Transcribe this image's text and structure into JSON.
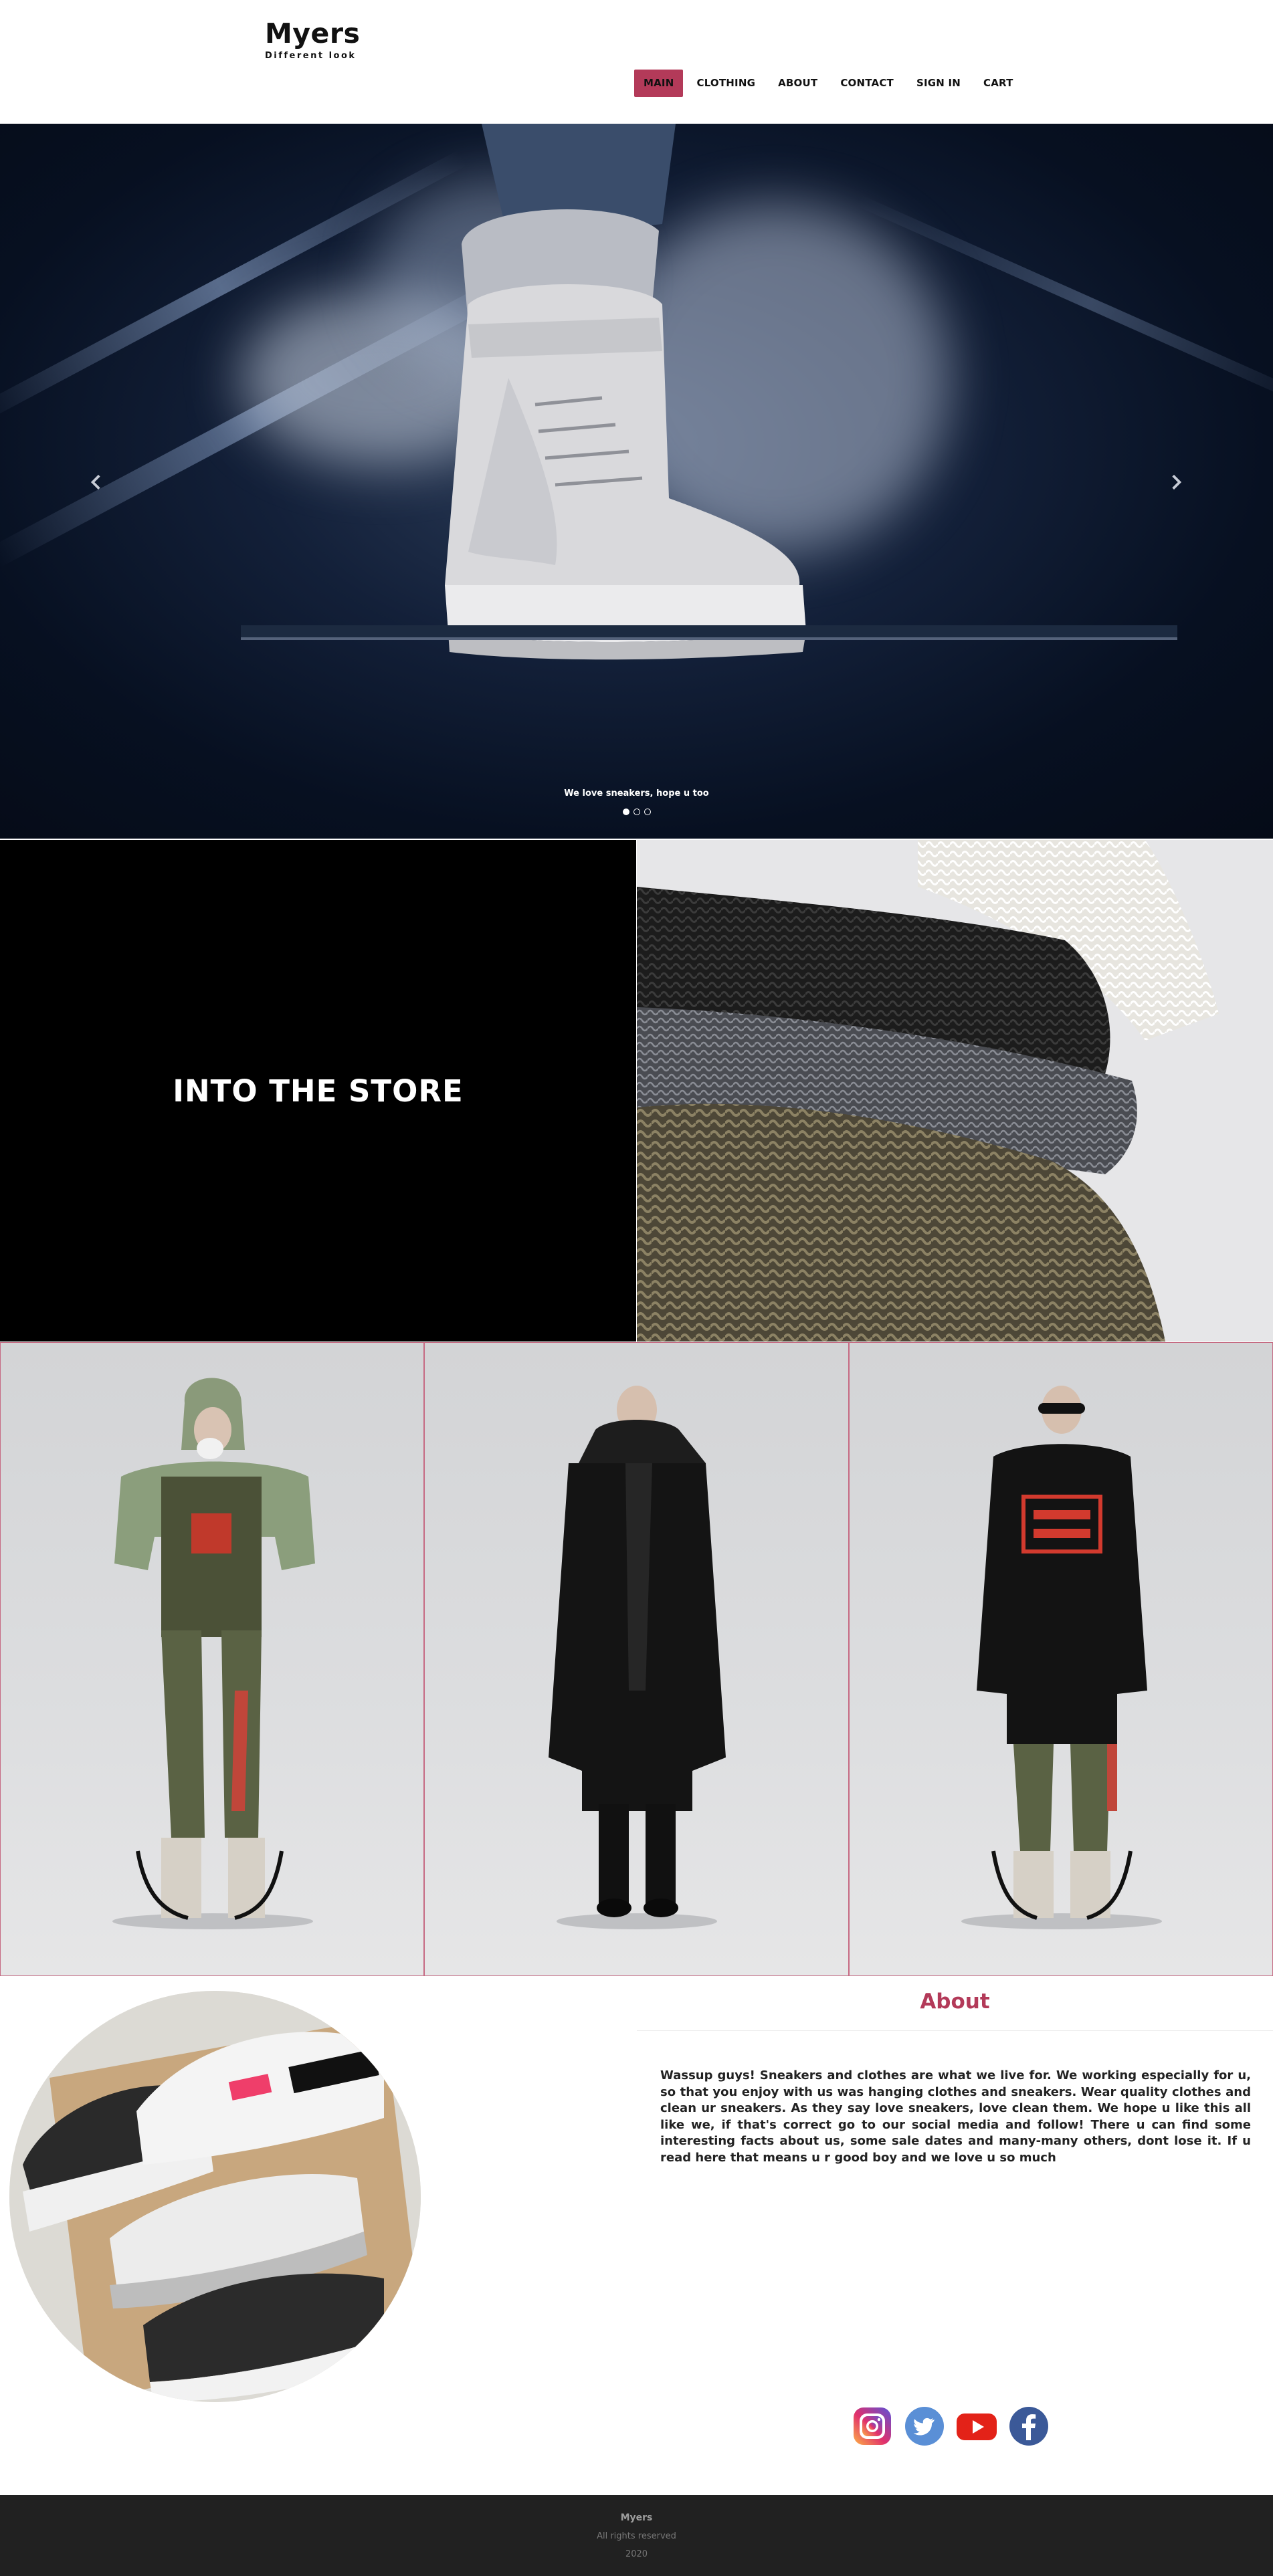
{
  "brand": {
    "name": "Myers",
    "tagline": "Different look"
  },
  "nav": {
    "items": [
      {
        "label": "MAIN",
        "active": true
      },
      {
        "label": "CLOTHING",
        "active": false
      },
      {
        "label": "ABOUT",
        "active": false
      },
      {
        "label": "CONTACT",
        "active": false
      },
      {
        "label": "SIGN IN",
        "active": false
      },
      {
        "label": "CART",
        "active": false
      }
    ]
  },
  "hero": {
    "caption": "We love sneakers, hope u too",
    "slide_count": 3,
    "active_slide": 1,
    "prev_icon": "chevron-left-icon",
    "next_icon": "chevron-right-icon"
  },
  "store": {
    "title": "INTO THE STORE"
  },
  "about": {
    "title": "About",
    "text": "Wassup guys! Sneakers and clothes are what we live for. We working especially for u, so that you enjoy with us was hanging clothes and sneakers. Wear quality clothes and clean ur sneakers. As they say love sneakers, love clean them. We hope u like this all like we, if that's correct go to our social media and follow! There u can find some interesting facts about us, some sale dates and many-many others, dont lose it. If u read here that means u r good boy and we love u so much"
  },
  "social": [
    {
      "name": "instagram-icon"
    },
    {
      "name": "twitter-icon"
    },
    {
      "name": "youtube-icon"
    },
    {
      "name": "facebook-icon"
    }
  ],
  "footer": {
    "brand": "Myers",
    "rights": "All rights reserved",
    "year": "2020"
  },
  "colors": {
    "accent": "#b33a59",
    "footer_bg": "#212121",
    "card_border": "#c66a83"
  }
}
